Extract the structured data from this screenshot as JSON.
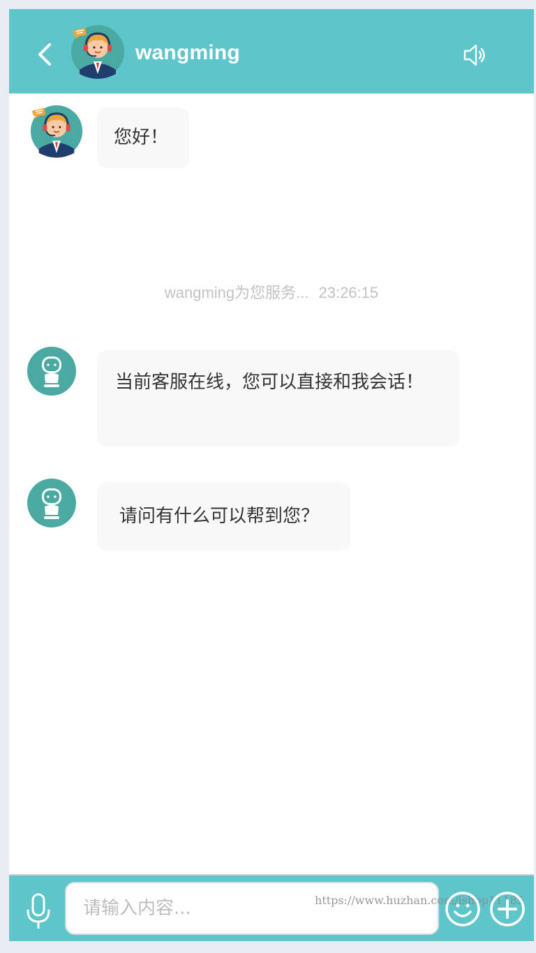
{
  "header": {
    "title": "wangming",
    "back_icon": "chevron-left-icon",
    "speaker_icon": "speaker-icon"
  },
  "messages": [
    {
      "sender": "agent",
      "text": "您好！"
    },
    {
      "sender": "bot",
      "text": "当前客服在线，您可以直接和我会话！"
    },
    {
      "sender": "bot",
      "text": "请问有什么可以帮到您？"
    }
  ],
  "system": {
    "service_text": "wangming为您服务...",
    "time": "23:26:15"
  },
  "composer": {
    "placeholder": "请输入内容...",
    "value": "",
    "watermark": "https://www.huzhan.com/ishop11185"
  },
  "colors": {
    "accent": "#5ec6cb",
    "bubble": "#f8f8f8",
    "bot_avatar": "#4aa9a0"
  }
}
